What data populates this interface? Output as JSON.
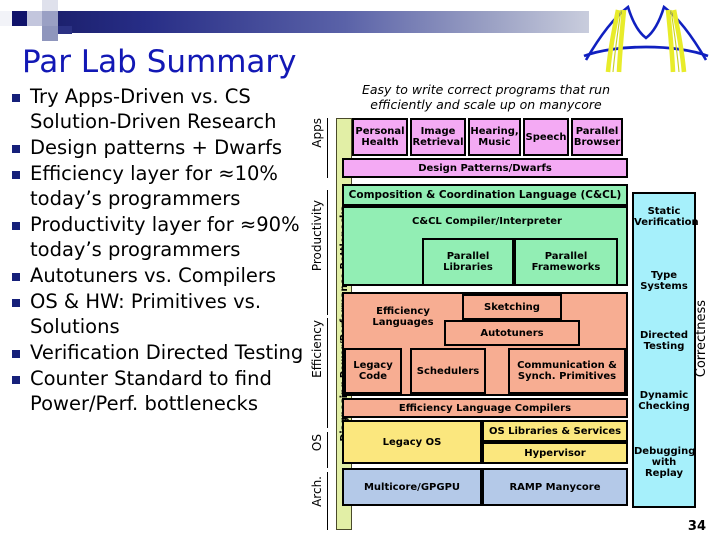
{
  "slide": {
    "title": "Par Lab Summary",
    "page_number": "34",
    "logo_name": "par-lab-bridge-logo"
  },
  "bullets": [
    "Try Apps-Driven vs. CS Solution-Driven Research",
    "Design patterns + Dwarfs",
    "Efficiency layer for ≈10% today’s programmers",
    "Productivity layer for ≈90% today’s programmers",
    "Autotuners vs. Compilers",
    "OS & HW: Primitives vs. Solutions",
    "Verification Directed Testing",
    "Counter Standard to find Power/Perf. bottlenecks"
  ],
  "diagram": {
    "tagline": "Easy to write correct programs that run efficiently and scale up on manycore",
    "layer_labels": [
      "Apps",
      "Productivity",
      "Efficiency",
      "OS",
      "Arch."
    ],
    "bottleneck_label": "Diagnosing Power/Performance Bottlenecks",
    "correctness_label": "Correctness",
    "apps": [
      "Personal Health",
      "Image Retrieval",
      "Hearing, Music",
      "Speech",
      "Parallel Browser"
    ],
    "patterns_bar": "Design Patterns/Dwarfs",
    "productivity": {
      "ccl": "Composition & Coordination Language (C&CL)",
      "compiler": "C&CL Compiler/Interpreter",
      "libraries": "Parallel Libraries",
      "frameworks": "Parallel Frameworks"
    },
    "efficiency": {
      "languages": "Efficiency Languages",
      "sketching": "Sketching",
      "autotuners": "Autotuners",
      "legacy_code": "Legacy Code",
      "schedulers": "Schedulers",
      "comm_sync": "Communication & Synch. Primitives",
      "compilers": "Efficiency Language Compilers"
    },
    "os": {
      "legacy_os": "Legacy OS",
      "os_libraries": "OS Libraries & Services",
      "hypervisor": "Hypervisor"
    },
    "arch": {
      "multicore": "Multicore/GPGPU",
      "ramp": "RAMP Manycore"
    },
    "correctness_items": [
      "Static Verification",
      "Type Systems",
      "Directed Testing",
      "Dynamic Checking",
      "Debugging with Replay"
    ]
  },
  "colors": {
    "title": "#1218b5",
    "apps": "#f4aaf4",
    "productivity": "#92eeb4",
    "efficiency": "#f7ad92",
    "os": "#fbe77e",
    "arch": "#b4c9e8",
    "correctness": "#a6f0fb",
    "bottleneck": "#e2efa6"
  }
}
